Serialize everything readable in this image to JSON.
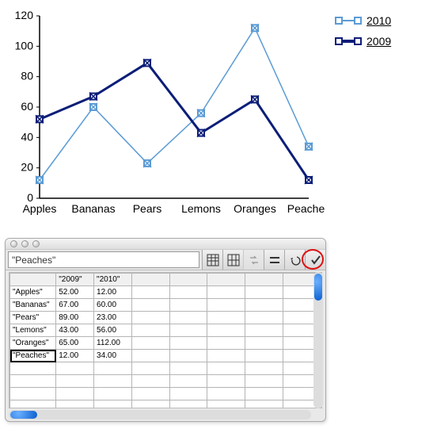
{
  "chart_data": {
    "type": "line",
    "categories": [
      "Apples",
      "Bananas",
      "Pears",
      "Lemons",
      "Oranges",
      "Peaches"
    ],
    "series": [
      {
        "name": "2010",
        "values": [
          12,
          60,
          23,
          56,
          112,
          34
        ],
        "color": "#5b9bd5",
        "weight": 1.5
      },
      {
        "name": "2009",
        "values": [
          52,
          67,
          89,
          43,
          65,
          12
        ],
        "color": "#0b1e78",
        "weight": 3
      }
    ],
    "ylim": [
      0,
      120
    ],
    "yticks": [
      0,
      20,
      40,
      60,
      80,
      100,
      120
    ],
    "xlabel": "",
    "ylabel": "",
    "title": ""
  },
  "legend": [
    {
      "label": "2010",
      "color": "#5b9bd5",
      "weight": 1
    },
    {
      "label": "2009",
      "color": "#0b1e78",
      "weight": 3
    }
  ],
  "editor": {
    "formula_value": "\"Peaches\"",
    "columns": [
      "",
      "\"2009\"",
      "\"2010\""
    ],
    "rows": [
      {
        "label": "\"Apples\"",
        "c1": "52.00",
        "c2": "12.00"
      },
      {
        "label": "\"Bananas\"",
        "c1": "67.00",
        "c2": "60.00"
      },
      {
        "label": "\"Pears\"",
        "c1": "89.00",
        "c2": "23.00"
      },
      {
        "label": "\"Lemons\"",
        "c1": "43.00",
        "c2": "56.00"
      },
      {
        "label": "\"Oranges\"",
        "c1": "65.00",
        "c2": "112.00"
      },
      {
        "label": "\"Peaches\"",
        "c1": "12.00",
        "c2": "34.00"
      }
    ],
    "selected_row": 5,
    "selected_col": 0
  }
}
